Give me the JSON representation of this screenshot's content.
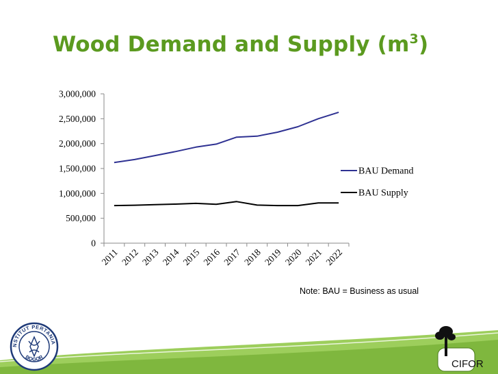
{
  "slide": {
    "title_main": "Wood Demand and Supply (m",
    "title_sup": "3",
    "title_end": ")",
    "note": "Note: BAU = Business as usual"
  },
  "logos": {
    "ipb_text_top": "INSTITUT PERTANIAN",
    "ipb_text_bottom": "BOGOR",
    "cifor_text": "CIFOR"
  },
  "colors": {
    "title": "#5b9a1f",
    "demand": "#2e3192",
    "supply": "#000000",
    "footer_green": "#8cc63f"
  },
  "chart_data": {
    "type": "line",
    "x": [
      "2011",
      "2012",
      "2013",
      "2014",
      "2015",
      "2016",
      "2017",
      "2018",
      "2019",
      "2020",
      "2021",
      "2022"
    ],
    "series": [
      {
        "name": "BAU Demand",
        "values": [
          1620000,
          1680000,
          1760000,
          1840000,
          1930000,
          1990000,
          2130000,
          2150000,
          2230000,
          2340000,
          2500000,
          2630000
        ]
      },
      {
        "name": "BAU Supply",
        "values": [
          755000,
          762000,
          775000,
          785000,
          800000,
          780000,
          835000,
          765000,
          755000,
          755000,
          808000,
          808000
        ]
      }
    ],
    "yticks": [
      "0",
      "500,000",
      "1,000,000",
      "1,500,000",
      "2,000,000",
      "2,500,000",
      "3,000,000"
    ],
    "ylim": [
      0,
      3000000
    ],
    "legend_position": "right",
    "grid": false
  }
}
